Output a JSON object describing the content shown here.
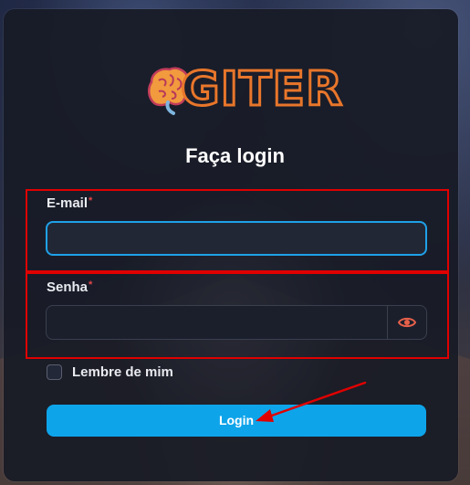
{
  "brand": {
    "logo_text": "GITER",
    "logo_icon": "brain-icon"
  },
  "form": {
    "title": "Faça login",
    "email": {
      "label": "E-mail",
      "required_mark": "*",
      "value": "",
      "placeholder": ""
    },
    "password": {
      "label": "Senha",
      "required_mark": "*",
      "value": "",
      "placeholder": "",
      "toggle_icon": "eye-icon"
    },
    "remember": {
      "label": "Lembre de mim",
      "checked": false
    },
    "submit_label": "Login"
  },
  "colors": {
    "accent": "#0ea4ea",
    "focus_border": "#1fa1e8",
    "annotation": "#e00000",
    "logo_stroke": "#e8762b",
    "eye_icon": "#e8614a"
  }
}
